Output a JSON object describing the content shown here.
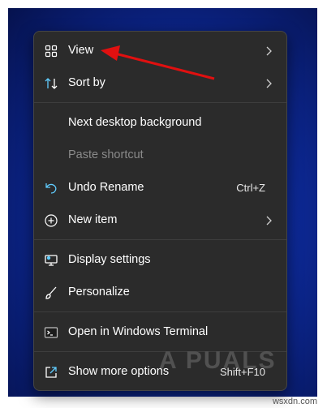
{
  "menu": {
    "items": [
      {
        "label": "View",
        "icon": "grid-icon",
        "submenu": true
      },
      {
        "label": "Sort by",
        "icon": "sort-icon",
        "submenu": true
      },
      {
        "label": "Next desktop background"
      },
      {
        "label": "Paste shortcut",
        "disabled": true
      },
      {
        "label": "Undo Rename",
        "icon": "undo-icon",
        "shortcut": "Ctrl+Z"
      },
      {
        "label": "New item",
        "icon": "plus-circle-icon",
        "submenu": true
      },
      {
        "label": "Display settings",
        "icon": "monitor-icon"
      },
      {
        "label": "Personalize",
        "icon": "brush-icon"
      },
      {
        "label": "Open in Windows Terminal",
        "icon": "terminal-icon"
      },
      {
        "label": "Show more options",
        "icon": "share-icon",
        "shortcut": "Shift+F10"
      }
    ]
  },
  "watermark": "A PUALS",
  "site": "wsxdn.com",
  "colors": {
    "accent_icon": "#60cdff",
    "arrow": "#e01010",
    "menu_bg": "#2b2b2b"
  }
}
